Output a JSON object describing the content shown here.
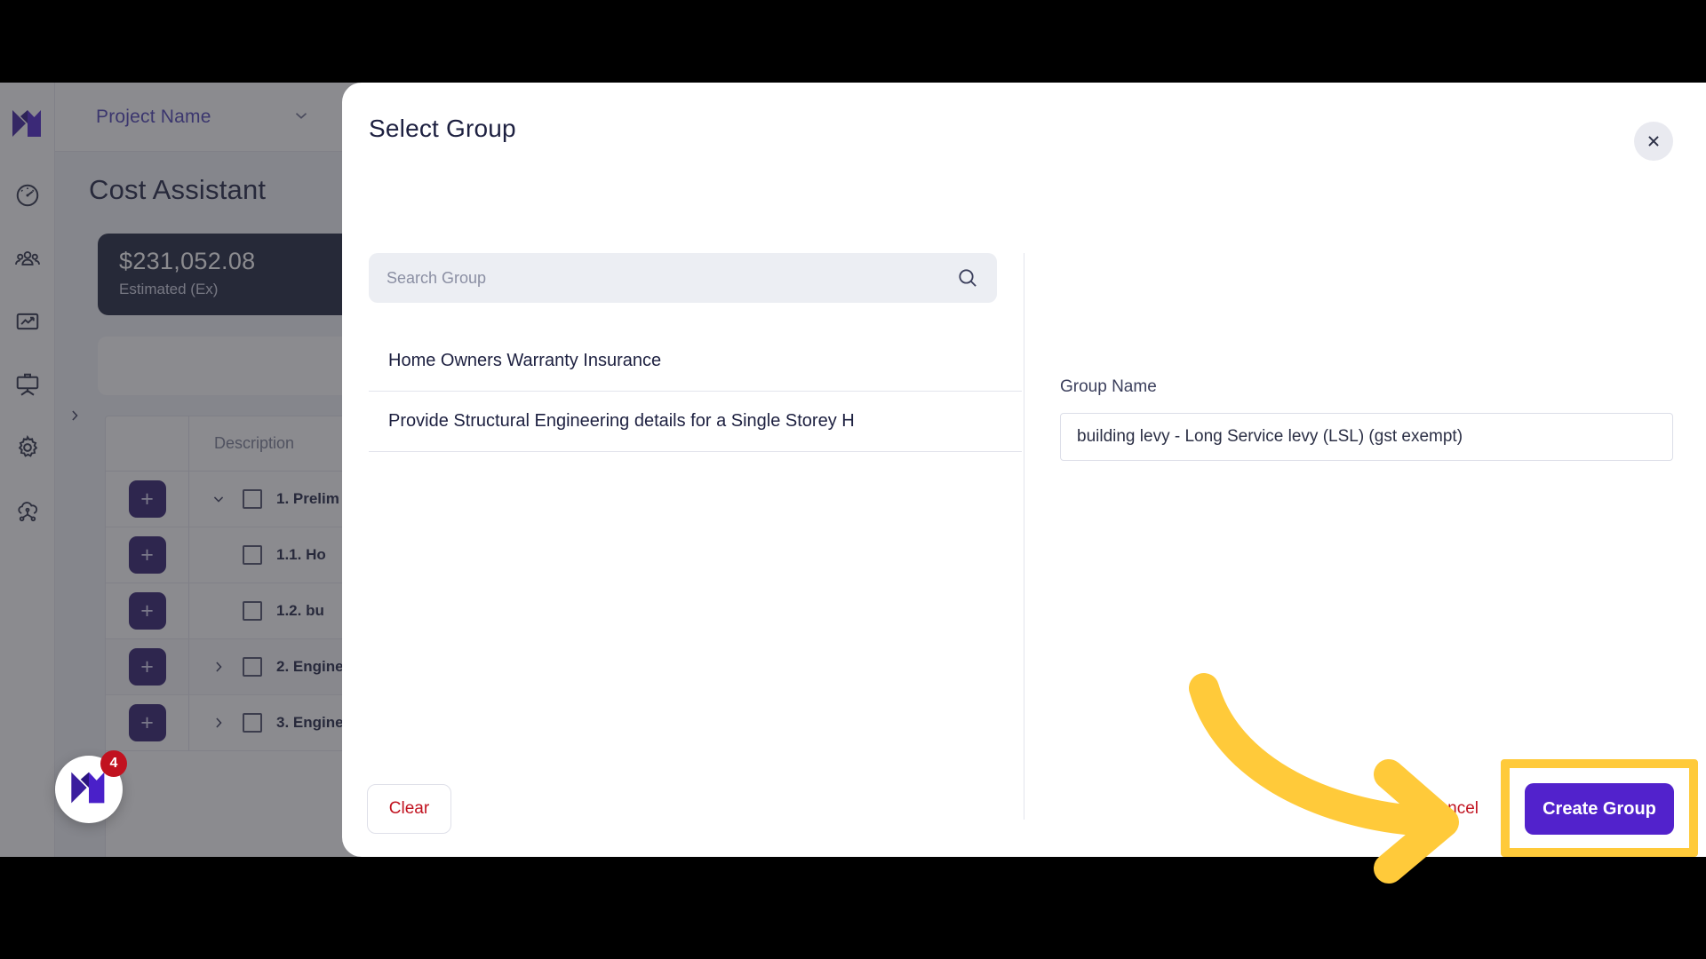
{
  "app": {
    "project_selector": {
      "label": "Project Name",
      "chevron": "chevron-down-icon"
    },
    "page_title": "Cost Assistant",
    "summary_card": {
      "amount": "$231,052.08",
      "caption": "Estimated (Ex)"
    },
    "rail": [
      {
        "name": "logo",
        "icon": "brand-logo-icon"
      },
      {
        "name": "dashboard",
        "icon": "gauge-icon"
      },
      {
        "name": "team",
        "icon": "people-icon"
      },
      {
        "name": "reports",
        "icon": "chart-frame-icon"
      },
      {
        "name": "presentations",
        "icon": "easel-icon"
      },
      {
        "name": "settings",
        "icon": "gear-icon"
      },
      {
        "name": "integrations",
        "icon": "cloud-network-icon"
      }
    ],
    "chat_widget": {
      "badge": "4",
      "icon": "brand-logo-icon"
    },
    "table": {
      "columns": [
        "",
        "Description"
      ],
      "add_label": "+",
      "rows": [
        {
          "twisty": "chevron-down-icon",
          "indent": 0,
          "text": "1. Prelim"
        },
        {
          "twisty": "",
          "indent": 1,
          "text": "1.1. Ho"
        },
        {
          "twisty": "",
          "indent": 1,
          "text": "1.2. bu"
        },
        {
          "twisty": "chevron-right-icon",
          "indent": 0,
          "text": "2. Engine"
        },
        {
          "twisty": "chevron-right-icon",
          "indent": 0,
          "text": "3. Engine"
        }
      ]
    },
    "collapse_caret": "chevron-right-icon"
  },
  "modal": {
    "title": "Select Group",
    "close_icon": "close-icon",
    "search": {
      "placeholder": "Search Group",
      "value": "",
      "icon": "search-icon"
    },
    "groups": [
      "Home Owners Warranty Insurance",
      "Provide Structural Engineering details for a Single Storey H"
    ],
    "group_name": {
      "label": "Group Name",
      "value": "building levy - Long Service levy (LSL) (gst exempt)"
    },
    "footer": {
      "clear_label": "Clear",
      "cancel_label": "Cancel",
      "create_label": "Create Group"
    }
  },
  "annotation": {
    "arrow": "curved-arrow-right",
    "arrow_color": "#FFCA3A",
    "highlight_color": "#FFCA3A",
    "highlight_target": "Create Group"
  },
  "colors": {
    "brand_purple": "#5222CC",
    "dark_navy": "#1B2039",
    "danger_red": "#C1121F",
    "badge_red": "#C1121F",
    "accent_yellow": "#FFCA3A"
  }
}
